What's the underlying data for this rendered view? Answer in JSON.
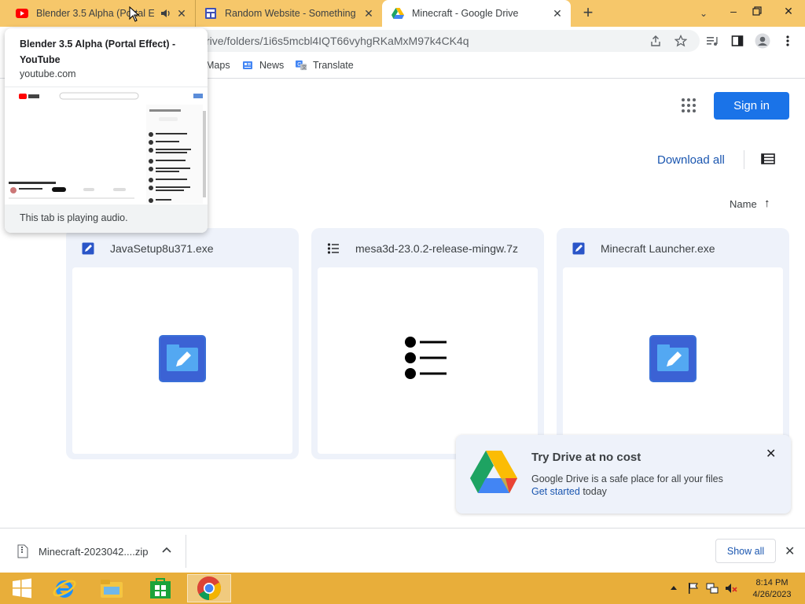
{
  "browser": {
    "tabs": [
      {
        "title": "Blender 3.5 Alpha (Portal Effect)",
        "favicon": "youtube-icon",
        "playing_audio": true
      },
      {
        "title": "Random Website - Something",
        "favicon": "website-icon"
      },
      {
        "title": "Minecraft - Google Drive",
        "favicon": "google-drive-icon",
        "active": true
      }
    ],
    "new_tab_label": "+",
    "url": "rive/folders/1i6s5mcbl4IQT66vyhgRKaMxM97k4CK4q",
    "bookmarks": [
      {
        "label": "Maps"
      },
      {
        "label": "News"
      },
      {
        "label": "Translate"
      }
    ]
  },
  "tooltip": {
    "title": "Blender 3.5 Alpha (Portal Effect) - YouTube",
    "domain": "youtube.com",
    "status": "This tab is playing audio."
  },
  "drive": {
    "signin_label": "Sign in",
    "download_all_label": "Download all",
    "sort_label": "Name",
    "sort_arrow": "↑",
    "files": [
      {
        "name": "JavaSetup8u371.exe",
        "icon": "executable-icon"
      },
      {
        "name": "mesa3d-23.0.2-release-mingw.7z",
        "icon": "archive-list-icon"
      },
      {
        "name": "Minecraft Launcher.exe",
        "icon": "executable-icon"
      }
    ],
    "promo": {
      "title": "Try Drive at no cost",
      "body": "Google Drive is a safe place for all your files",
      "link": "Get started",
      "link_suffix": " today"
    }
  },
  "download_bar": {
    "filename": "Minecraft-2023042....zip",
    "show_all_label": "Show all"
  },
  "taskbar": {
    "time": "8:14 PM",
    "date": "4/26/2023"
  },
  "colors": {
    "tabstrip": "#f6c76a",
    "taskbar": "#e8ae3a",
    "accent": "#1a73e8",
    "link": "#1a56b0"
  }
}
